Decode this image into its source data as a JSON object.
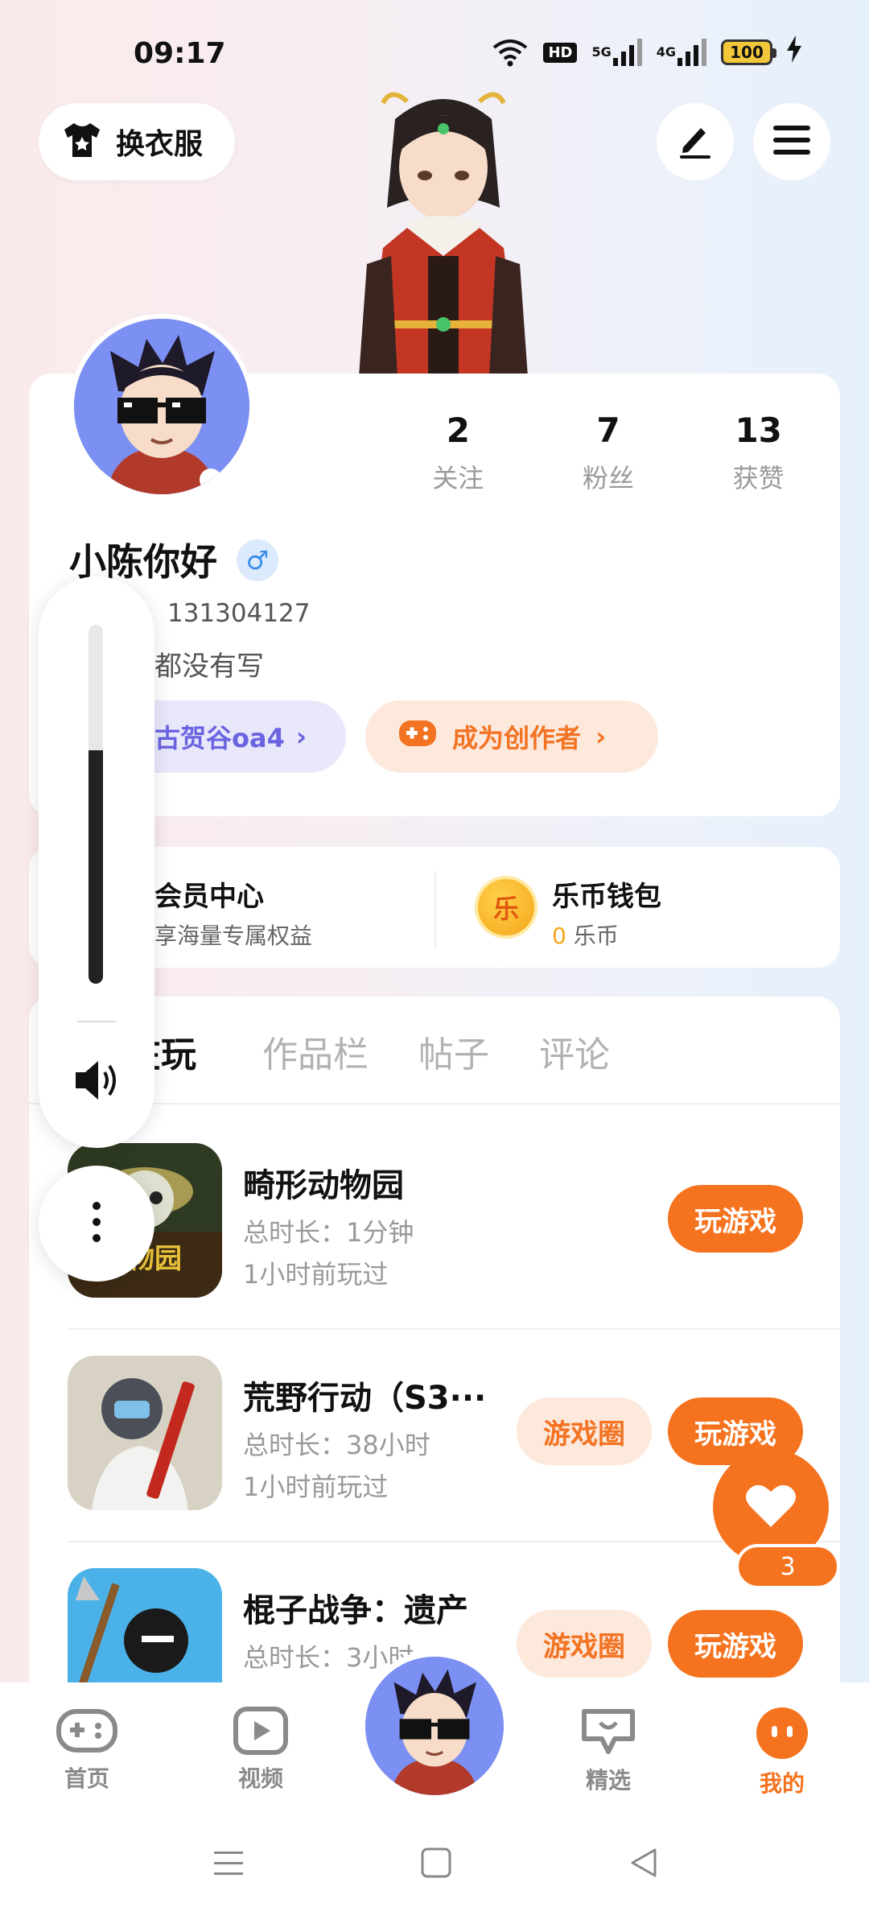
{
  "status_bar": {
    "time": "09:17",
    "hd_label": "HD",
    "net1": "5G",
    "net2": "4G",
    "battery": "100"
  },
  "top_actions": {
    "outfit_label": "换衣服"
  },
  "profile": {
    "stats": [
      {
        "num": "2",
        "label": "关注"
      },
      {
        "num": "7",
        "label": "粉丝"
      },
      {
        "num": "13",
        "label": "获赞"
      }
    ],
    "name": "小陈你好",
    "gender_symbol": "♂",
    "id_text": "131304127",
    "bio": "都没有写",
    "guild_pill": "古贺谷oa4",
    "creator_pill": "成为创作者",
    "chevron": "›"
  },
  "member": {
    "vip_title": "会员中心",
    "vip_sub": "享海量专属权益",
    "wallet_title": "乐币钱包",
    "wallet_amount": "0",
    "wallet_unit": "乐币",
    "coin_glyph": "乐"
  },
  "tabs": [
    "在玩",
    "作品栏",
    "帖子",
    "评论"
  ],
  "games": [
    {
      "name": "畸形动物园",
      "duration": "总时长：1分钟",
      "last": "1小时前玩过",
      "circle": "",
      "play": "玩游戏",
      "icon_text": "动物园"
    },
    {
      "name": "荒野行动（S3···",
      "duration": "总时长：38小时",
      "last": "1小时前玩过",
      "circle": "游戏圈",
      "play": "玩游戏",
      "icon_text": ""
    },
    {
      "name": "棍子战争：遗产",
      "duration": "总时长：3小时",
      "last": "",
      "circle": "游戏圈",
      "play": "玩游戏",
      "icon_text": ""
    }
  ],
  "volume": {
    "level": 0.65
  },
  "like": {
    "count": "3"
  },
  "bottom_nav": [
    {
      "label": "首页",
      "icon": "gamepad-icon"
    },
    {
      "label": "视频",
      "icon": "video-icon"
    },
    {
      "label": "精选",
      "icon": "heart-chat-icon"
    },
    {
      "label": "我的",
      "icon": "face-icon"
    }
  ],
  "colors": {
    "accent": "#f5731f",
    "purple": "#6a64e0",
    "avatar_bg": "#7c8ff2"
  }
}
